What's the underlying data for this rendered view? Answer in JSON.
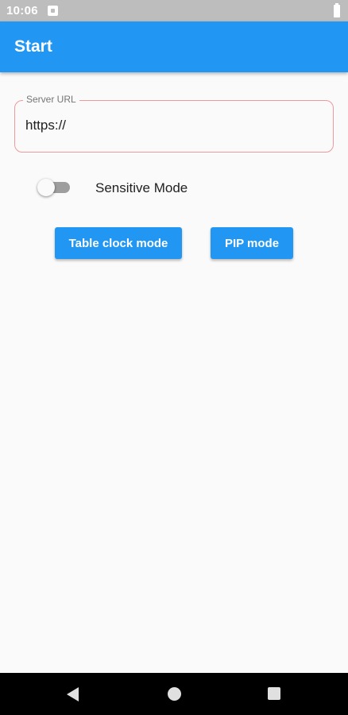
{
  "status_bar": {
    "time": "10:06",
    "notification_icon": "notification-icon",
    "battery_icon": "battery-icon"
  },
  "app_bar": {
    "title": "Start",
    "color": "#2196f3"
  },
  "server_url": {
    "label": "Server URL",
    "value": "https://",
    "border_color": "#ef9a9a"
  },
  "sensitive_mode": {
    "label": "Sensitive Mode",
    "enabled": false
  },
  "buttons": {
    "table_clock": "Table clock mode",
    "pip": "PIP mode"
  },
  "nav_bar": {
    "back_icon": "back-triangle-icon",
    "home_icon": "home-circle-icon",
    "recents_icon": "recents-square-icon"
  }
}
